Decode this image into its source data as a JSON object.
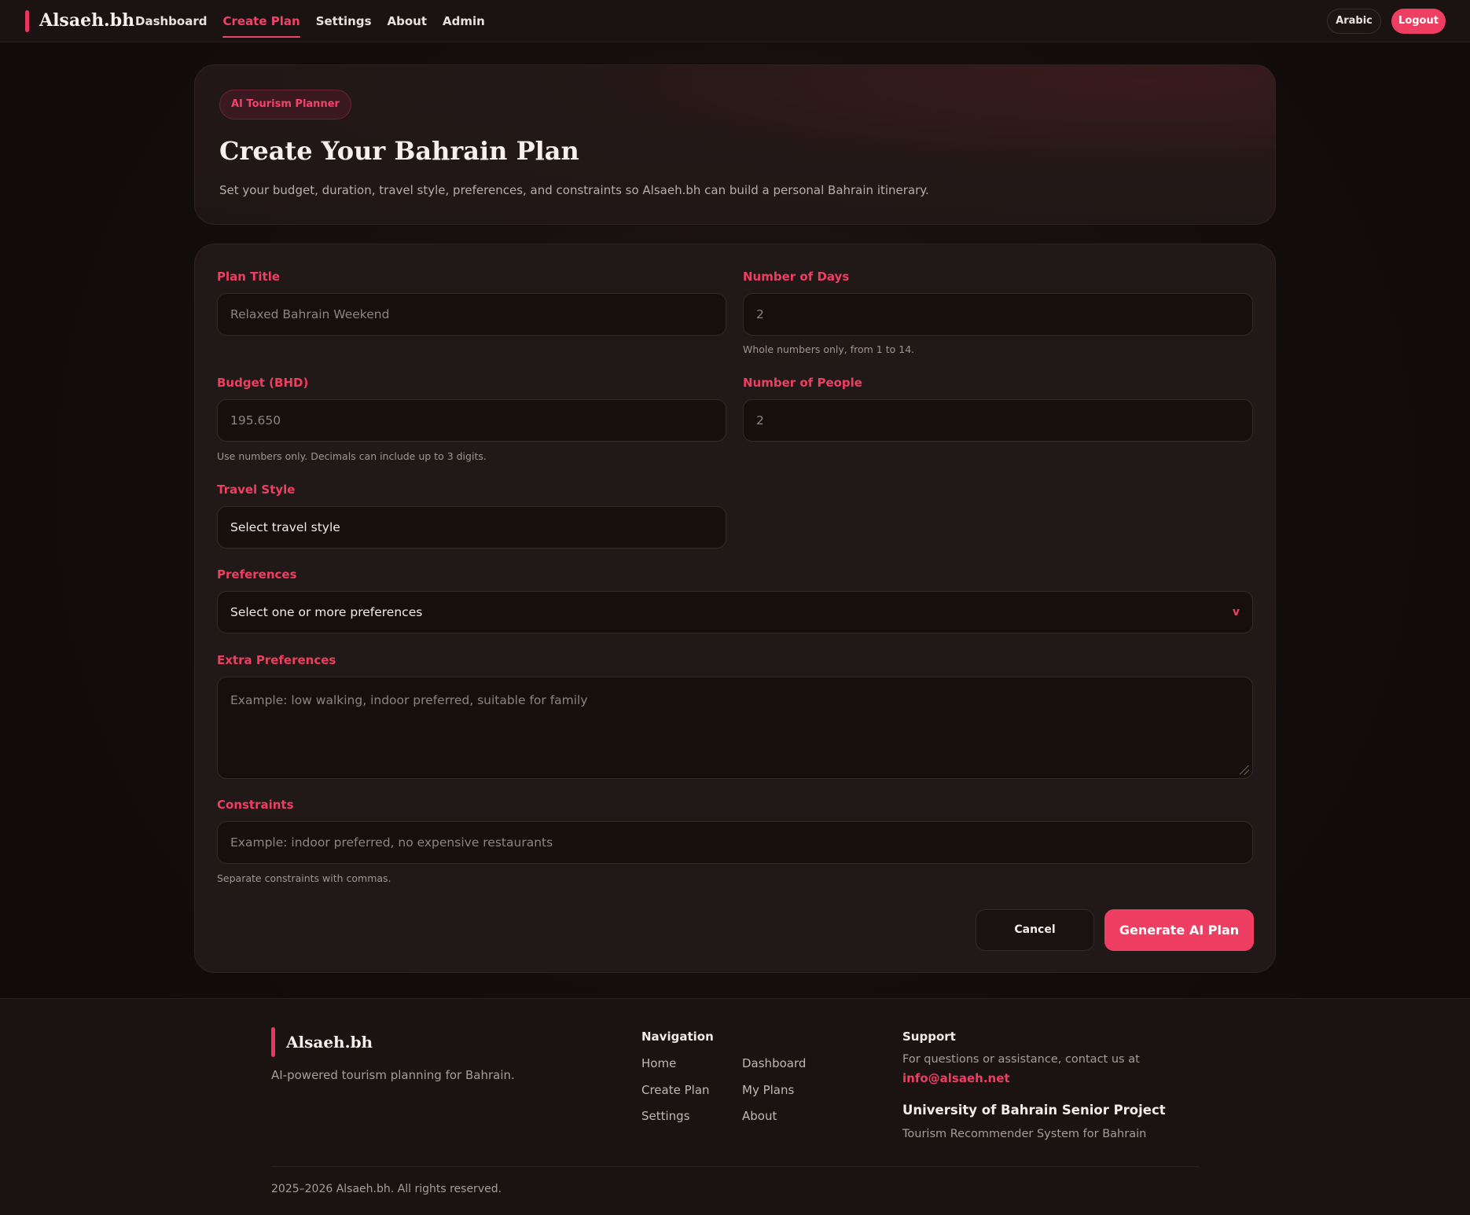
{
  "header": {
    "brand": "Alsaeh.bh",
    "nav": [
      {
        "label": "Dashboard",
        "active": false
      },
      {
        "label": "Create Plan",
        "active": true
      },
      {
        "label": "Settings",
        "active": false
      },
      {
        "label": "About",
        "active": false
      },
      {
        "label": "Admin",
        "active": false
      }
    ],
    "language_button": "Arabic",
    "logout_button": "Logout"
  },
  "hero": {
    "badge": "AI Tourism Planner",
    "title": "Create Your Bahrain Plan",
    "description": "Set your budget, duration, travel style, preferences, and constraints so Alsaeh.bh can build a personal Bahrain itinerary."
  },
  "form": {
    "plan_title": {
      "label": "Plan Title",
      "placeholder": "Relaxed Bahrain Weekend"
    },
    "days": {
      "label": "Number of Days",
      "placeholder": "2",
      "hint": "Whole numbers only, from 1 to 14."
    },
    "budget": {
      "label": "Budget (BHD)",
      "placeholder": "195.650",
      "hint": "Use numbers only. Decimals can include up to 3 digits."
    },
    "people": {
      "label": "Number of People",
      "placeholder": "2"
    },
    "travel_style": {
      "label": "Travel Style",
      "value": "Select travel style"
    },
    "preferences": {
      "label": "Preferences",
      "value": "Select one or more preferences",
      "chevron": "v"
    },
    "extra_preferences": {
      "label": "Extra Preferences",
      "placeholder": "Example: low walking, indoor preferred, suitable for family"
    },
    "constraints": {
      "label": "Constraints",
      "placeholder": "Example: indoor preferred, no expensive restaurants",
      "hint": "Separate constraints with commas."
    },
    "cancel_button": "Cancel",
    "generate_button": "Generate AI Plan"
  },
  "footer": {
    "brand": "Alsaeh.bh",
    "tagline": "AI-powered tourism planning for Bahrain.",
    "navigation_heading": "Navigation",
    "links_col1": [
      "Home",
      "Create Plan",
      "Settings"
    ],
    "links_col2": [
      "Dashboard",
      "My Plans",
      "About"
    ],
    "support_heading": "Support",
    "support_text": "For questions or assistance, contact us at",
    "support_email": "info@alsaeh.net",
    "university": "University of Bahrain Senior Project",
    "project": "Tourism Recommender System for Bahrain",
    "copyright": "2025–2026 Alsaeh.bh. All rights reserved."
  },
  "colors": {
    "accent": "#ee3e62",
    "background": "#120c0b",
    "card": "#211917"
  }
}
